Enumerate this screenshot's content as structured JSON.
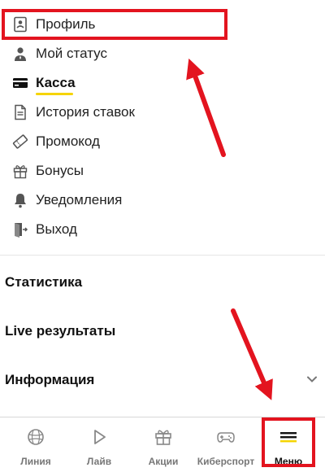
{
  "menu": {
    "items": [
      {
        "label": "Профиль",
        "icon": "profile-card-icon"
      },
      {
        "label": "Мой статус",
        "icon": "user-status-icon"
      },
      {
        "label": "Касса",
        "icon": "credit-card-icon",
        "active": true
      },
      {
        "label": "История ставок",
        "icon": "document-history-icon"
      },
      {
        "label": "Промокод",
        "icon": "ticket-icon"
      },
      {
        "label": "Бонусы",
        "icon": "gift-icon"
      },
      {
        "label": "Уведомления",
        "icon": "bell-icon"
      },
      {
        "label": "Выход",
        "icon": "exit-door-icon"
      }
    ]
  },
  "sections": {
    "stats": "Статистика",
    "live_results": "Live результаты",
    "info": "Информация"
  },
  "tabbar": {
    "tabs": [
      {
        "label": "Линия",
        "icon": "ball-icon"
      },
      {
        "label": "Лайв",
        "icon": "play-icon"
      },
      {
        "label": "Акции",
        "icon": "gift-icon"
      },
      {
        "label": "Киберспорт",
        "icon": "gamepad-icon"
      },
      {
        "label": "Меню",
        "icon": "menu-icon",
        "active": true
      }
    ]
  },
  "colors": {
    "accent_yellow": "#f5d400",
    "annotation_red": "#e3141f"
  }
}
